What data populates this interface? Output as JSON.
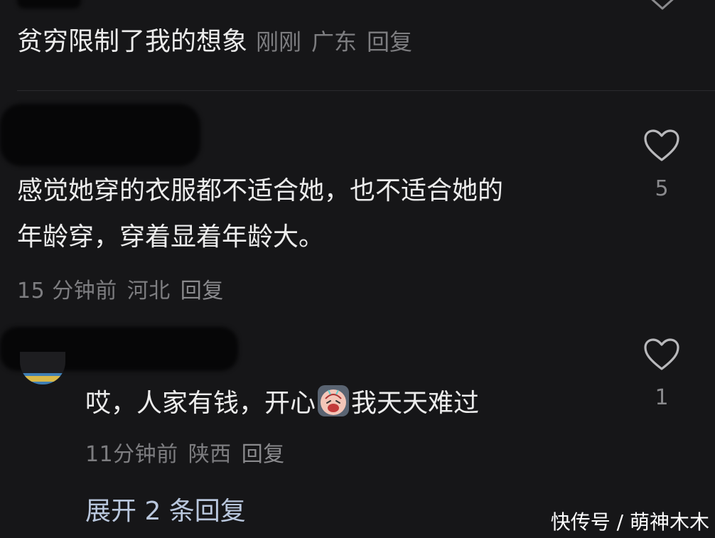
{
  "comments": [
    {
      "text": "贫穷限制了我的想象",
      "time": "刚刚",
      "location": "广东",
      "reply_label": "回复"
    },
    {
      "text_line1": "感觉她穿的衣服都不适合她，也不适合她的",
      "text_line2": "年龄穿，穿着显着年龄大。",
      "time": "15 分钟前",
      "location": "河北",
      "reply_label": "回复",
      "likes": "5"
    },
    {
      "text_before_emoji": "哎，人家有钱，开心",
      "text_after_emoji": "我天天难过",
      "emoji_icon": "crying-face-sticker",
      "time": "11分钟前",
      "location": "陕西",
      "reply_label": "回复",
      "likes": "1"
    }
  ],
  "expand_replies": "展开 2 条回复",
  "watermark": "快传号 / 萌神木木",
  "colors": {
    "background": "#161618",
    "text": "#ececec",
    "meta": "#7d7d80",
    "link": "#b9c7dd"
  }
}
